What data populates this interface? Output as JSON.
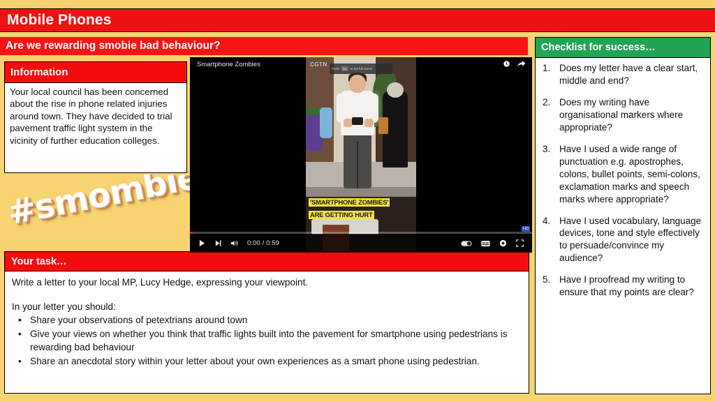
{
  "slide": {
    "title": "Mobile Phones",
    "subtitle": "Are we rewarding smobie bad behaviour?",
    "wordart": "#smombie",
    "colors": {
      "background": "#f7d372",
      "title_red": "#ee1111",
      "header_red": "#f40d0d",
      "checklist_green": "#21a453",
      "text_black": "#111111",
      "panel_white": "#ffffff"
    }
  },
  "information": {
    "heading": "Information",
    "body": "Your local council has been concerned about the rise in phone related injuries around town.  They have decided to trial pavement traffic light system in the vicinity of further education colleges."
  },
  "task": {
    "heading": "Your task…",
    "lead": "Write a letter to your local MP, Lucy Hedge, expressing your viewpoint.",
    "sublead": "In your letter you should:",
    "bullet_char": "•",
    "bullets": [
      "Share your observations of petextrians around town",
      "Give your views on whether you think that traffic lights built into the pavement for smartphone using pedestrians is rewarding bad behaviour",
      "Share an anecdotal story within your letter about your own experiences as a smart phone using pedestrian."
    ]
  },
  "checklist": {
    "heading": "Checklist for success…",
    "items": [
      {
        "number": "1.",
        "text": "Does my letter have a clear start, middle and end?"
      },
      {
        "number": "2.",
        "text": "Does my writing have organisational markers where appropriate?"
      },
      {
        "number": "3.",
        "text": "Have I used a wide range of punctuation e.g. apostrophes, colons, bullet points, semi-colons, exclamation marks and speech marks where appropriate?"
      },
      {
        "number": "4.",
        "text": "Have I used vocabulary, language devices, tone and style effectively to persuade/convince my audience?"
      },
      {
        "number": "5.",
        "text": "Have I proofread my writing to ensure that my points are clear?"
      }
    ]
  },
  "video": {
    "title": "Smartphone Zombies",
    "current_time": "0:00",
    "duration": "0:59",
    "time_display": "0:00 / 0:59",
    "caption_line1": "'SMARTPHONE ZOMBIES'",
    "caption_line2": "ARE GETTING HURT",
    "channel_logo": "CGTN",
    "overlay_chip": "tap",
    "overlay_text": "to see full screen",
    "overlay_prefix": "Press",
    "badge": "HD",
    "icons": {
      "watch_later": "watch-later-icon",
      "share": "share-icon",
      "play": "play-icon",
      "next": "next-icon",
      "volume": "volume-icon",
      "autoplay": "autoplay-toggle-icon",
      "subtitles": "subtitles-icon",
      "settings": "settings-gear-icon",
      "fullscreen": "fullscreen-icon"
    }
  }
}
